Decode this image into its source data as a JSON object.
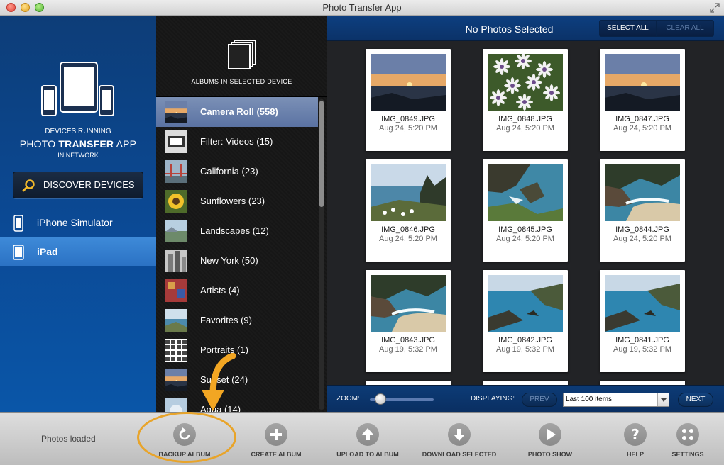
{
  "window": {
    "title": "Photo Transfer App"
  },
  "left_panel": {
    "line1": "DEVICES RUNNING",
    "line2_a": "PHOTO ",
    "line2_b": "TRANSFER",
    "line2_c": " APP",
    "line3": "IN NETWORK",
    "discover_label": "DISCOVER DEVICES",
    "devices": [
      {
        "label": "iPhone Simulator",
        "selected": false
      },
      {
        "label": "iPad",
        "selected": true
      }
    ]
  },
  "albums": {
    "title": "ALBUMS IN SELECTED DEVICE",
    "items": [
      {
        "label": "Camera Roll (558)",
        "selected": true,
        "thumb": "sunset"
      },
      {
        "label": "Filter: Videos (15)",
        "selected": false,
        "thumb": "film"
      },
      {
        "label": "California (23)",
        "selected": false,
        "thumb": "bridge"
      },
      {
        "label": "Sunflowers (23)",
        "selected": false,
        "thumb": "sunflower"
      },
      {
        "label": "Landscapes (12)",
        "selected": false,
        "thumb": "landscape"
      },
      {
        "label": "New York (50)",
        "selected": false,
        "thumb": "city"
      },
      {
        "label": "Artists (4)",
        "selected": false,
        "thumb": "art"
      },
      {
        "label": "Favorites (9)",
        "selected": false,
        "thumb": "coast"
      },
      {
        "label": "Portraits (1)",
        "selected": false,
        "thumb": "grid"
      },
      {
        "label": "Sunset (24)",
        "selected": false,
        "thumb": "sunset"
      },
      {
        "label": "Aqua (14)",
        "selected": false,
        "thumb": "aqua"
      }
    ]
  },
  "photos": {
    "header": "No Photos Selected",
    "select_all": "SELECT ALL",
    "clear_all": "CLEAR ALL",
    "items": [
      {
        "name": "IMG_0849.JPG",
        "date": "Aug 24, 5:20 PM",
        "kind": "sunset"
      },
      {
        "name": "IMG_0848.JPG",
        "date": "Aug 24, 5:20 PM",
        "kind": "daisies"
      },
      {
        "name": "IMG_0847.JPG",
        "date": "Aug 24, 5:20 PM",
        "kind": "sunset"
      },
      {
        "name": "IMG_0846.JPG",
        "date": "Aug 24, 5:20 PM",
        "kind": "coast-flowers"
      },
      {
        "name": "IMG_0845.JPG",
        "date": "Aug 24, 5:20 PM",
        "kind": "coast-rocks"
      },
      {
        "name": "IMG_0844.JPG",
        "date": "Aug 24, 5:20 PM",
        "kind": "cove"
      },
      {
        "name": "IMG_0843.JPG",
        "date": "Aug 19, 5:32 PM",
        "kind": "cove"
      },
      {
        "name": "IMG_0842.JPG",
        "date": "Aug 19, 5:32 PM",
        "kind": "bay"
      },
      {
        "name": "IMG_0841.JPG",
        "date": "Aug 19, 5:32 PM",
        "kind": "bay"
      }
    ],
    "zoom_label": "ZOOM:",
    "zoom_level": 0.17,
    "displaying_label": "DISPLAYING:",
    "prev": "PREV",
    "next": "NEXT",
    "display_value": "Last 100 items"
  },
  "toolbar": {
    "status": "Photos loaded",
    "buttons": [
      {
        "label": "BACKUP ALBUM",
        "icon": "backup-icon"
      },
      {
        "label": "CREATE ALBUM",
        "icon": "plus-icon"
      },
      {
        "label": "UPLOAD TO ALBUM",
        "icon": "upload-icon"
      },
      {
        "label": "DOWNLOAD SELECTED",
        "icon": "download-icon"
      },
      {
        "label": "PHOTO SHOW",
        "icon": "play-icon"
      },
      {
        "label": "HELP",
        "icon": "help-icon"
      },
      {
        "label": "SETTINGS",
        "icon": "settings-icon"
      }
    ]
  }
}
